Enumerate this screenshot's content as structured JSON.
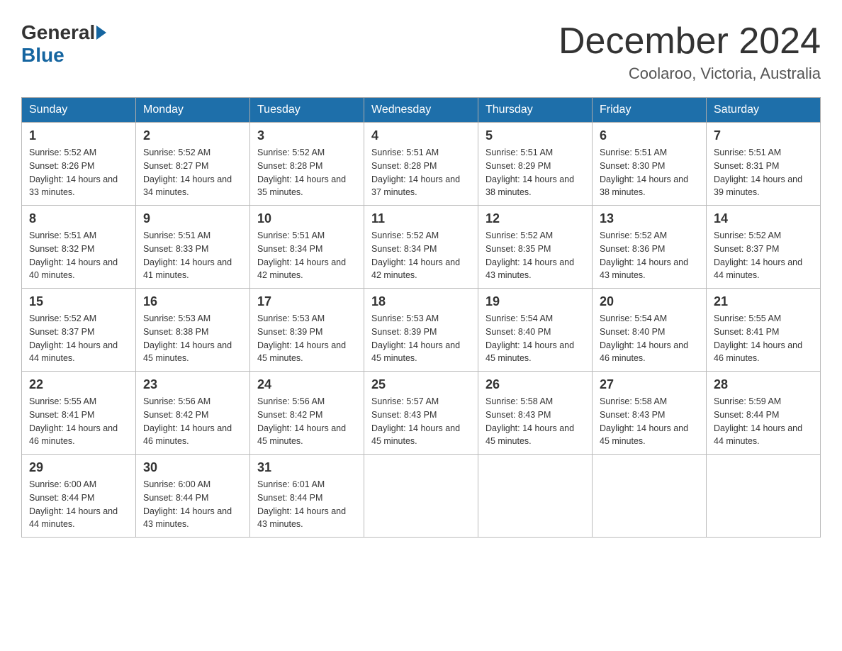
{
  "logo": {
    "general": "General",
    "blue": "Blue"
  },
  "header": {
    "month": "December 2024",
    "location": "Coolaroo, Victoria, Australia"
  },
  "weekdays": [
    "Sunday",
    "Monday",
    "Tuesday",
    "Wednesday",
    "Thursday",
    "Friday",
    "Saturday"
  ],
  "weeks": [
    [
      {
        "day": "1",
        "sunrise": "5:52 AM",
        "sunset": "8:26 PM",
        "daylight": "14 hours and 33 minutes."
      },
      {
        "day": "2",
        "sunrise": "5:52 AM",
        "sunset": "8:27 PM",
        "daylight": "14 hours and 34 minutes."
      },
      {
        "day": "3",
        "sunrise": "5:52 AM",
        "sunset": "8:28 PM",
        "daylight": "14 hours and 35 minutes."
      },
      {
        "day": "4",
        "sunrise": "5:51 AM",
        "sunset": "8:28 PM",
        "daylight": "14 hours and 37 minutes."
      },
      {
        "day": "5",
        "sunrise": "5:51 AM",
        "sunset": "8:29 PM",
        "daylight": "14 hours and 38 minutes."
      },
      {
        "day": "6",
        "sunrise": "5:51 AM",
        "sunset": "8:30 PM",
        "daylight": "14 hours and 38 minutes."
      },
      {
        "day": "7",
        "sunrise": "5:51 AM",
        "sunset": "8:31 PM",
        "daylight": "14 hours and 39 minutes."
      }
    ],
    [
      {
        "day": "8",
        "sunrise": "5:51 AM",
        "sunset": "8:32 PM",
        "daylight": "14 hours and 40 minutes."
      },
      {
        "day": "9",
        "sunrise": "5:51 AM",
        "sunset": "8:33 PM",
        "daylight": "14 hours and 41 minutes."
      },
      {
        "day": "10",
        "sunrise": "5:51 AM",
        "sunset": "8:34 PM",
        "daylight": "14 hours and 42 minutes."
      },
      {
        "day": "11",
        "sunrise": "5:52 AM",
        "sunset": "8:34 PM",
        "daylight": "14 hours and 42 minutes."
      },
      {
        "day": "12",
        "sunrise": "5:52 AM",
        "sunset": "8:35 PM",
        "daylight": "14 hours and 43 minutes."
      },
      {
        "day": "13",
        "sunrise": "5:52 AM",
        "sunset": "8:36 PM",
        "daylight": "14 hours and 43 minutes."
      },
      {
        "day": "14",
        "sunrise": "5:52 AM",
        "sunset": "8:37 PM",
        "daylight": "14 hours and 44 minutes."
      }
    ],
    [
      {
        "day": "15",
        "sunrise": "5:52 AM",
        "sunset": "8:37 PM",
        "daylight": "14 hours and 44 minutes."
      },
      {
        "day": "16",
        "sunrise": "5:53 AM",
        "sunset": "8:38 PM",
        "daylight": "14 hours and 45 minutes."
      },
      {
        "day": "17",
        "sunrise": "5:53 AM",
        "sunset": "8:39 PM",
        "daylight": "14 hours and 45 minutes."
      },
      {
        "day": "18",
        "sunrise": "5:53 AM",
        "sunset": "8:39 PM",
        "daylight": "14 hours and 45 minutes."
      },
      {
        "day": "19",
        "sunrise": "5:54 AM",
        "sunset": "8:40 PM",
        "daylight": "14 hours and 45 minutes."
      },
      {
        "day": "20",
        "sunrise": "5:54 AM",
        "sunset": "8:40 PM",
        "daylight": "14 hours and 46 minutes."
      },
      {
        "day": "21",
        "sunrise": "5:55 AM",
        "sunset": "8:41 PM",
        "daylight": "14 hours and 46 minutes."
      }
    ],
    [
      {
        "day": "22",
        "sunrise": "5:55 AM",
        "sunset": "8:41 PM",
        "daylight": "14 hours and 46 minutes."
      },
      {
        "day": "23",
        "sunrise": "5:56 AM",
        "sunset": "8:42 PM",
        "daylight": "14 hours and 46 minutes."
      },
      {
        "day": "24",
        "sunrise": "5:56 AM",
        "sunset": "8:42 PM",
        "daylight": "14 hours and 45 minutes."
      },
      {
        "day": "25",
        "sunrise": "5:57 AM",
        "sunset": "8:43 PM",
        "daylight": "14 hours and 45 minutes."
      },
      {
        "day": "26",
        "sunrise": "5:58 AM",
        "sunset": "8:43 PM",
        "daylight": "14 hours and 45 minutes."
      },
      {
        "day": "27",
        "sunrise": "5:58 AM",
        "sunset": "8:43 PM",
        "daylight": "14 hours and 45 minutes."
      },
      {
        "day": "28",
        "sunrise": "5:59 AM",
        "sunset": "8:44 PM",
        "daylight": "14 hours and 44 minutes."
      }
    ],
    [
      {
        "day": "29",
        "sunrise": "6:00 AM",
        "sunset": "8:44 PM",
        "daylight": "14 hours and 44 minutes."
      },
      {
        "day": "30",
        "sunrise": "6:00 AM",
        "sunset": "8:44 PM",
        "daylight": "14 hours and 43 minutes."
      },
      {
        "day": "31",
        "sunrise": "6:01 AM",
        "sunset": "8:44 PM",
        "daylight": "14 hours and 43 minutes."
      },
      null,
      null,
      null,
      null
    ]
  ]
}
